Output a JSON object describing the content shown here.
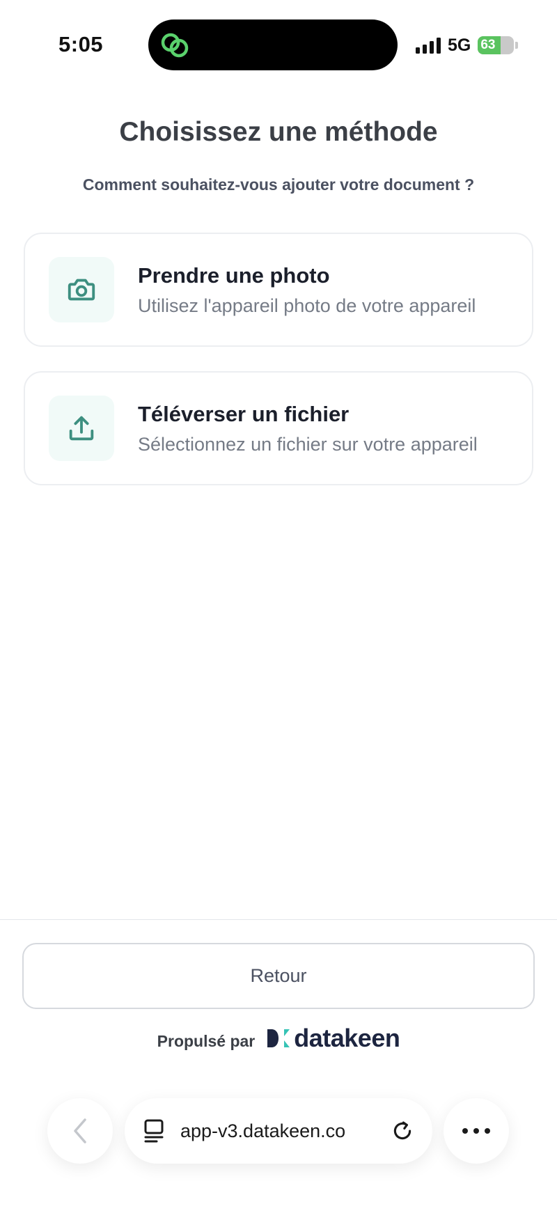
{
  "status_bar": {
    "time": "5:05",
    "network": "5G",
    "battery": "63",
    "battery_level": 0.63
  },
  "header": {
    "title": "Choisissez une méthode",
    "subtitle": "Comment souhaitez-vous ajouter votre document ?"
  },
  "options": [
    {
      "title": "Prendre une photo",
      "description": "Utilisez l'appareil photo de votre appareil",
      "icon": "camera-icon"
    },
    {
      "title": "Téléverser un fichier",
      "description": "Sélectionnez un fichier sur votre appareil",
      "icon": "upload-icon"
    }
  ],
  "footer": {
    "back_label": "Retour",
    "powered_by": "Propulsé par",
    "brand": "datakeen"
  },
  "browser": {
    "url": "app-v3.datakeen.co"
  },
  "colors": {
    "accent": "#3d8f80",
    "icon_bg": "#f1faf8",
    "brand_dark": "#1d2540",
    "brand_teal": "#36c3b5",
    "battery_green": "#5ac35f"
  }
}
